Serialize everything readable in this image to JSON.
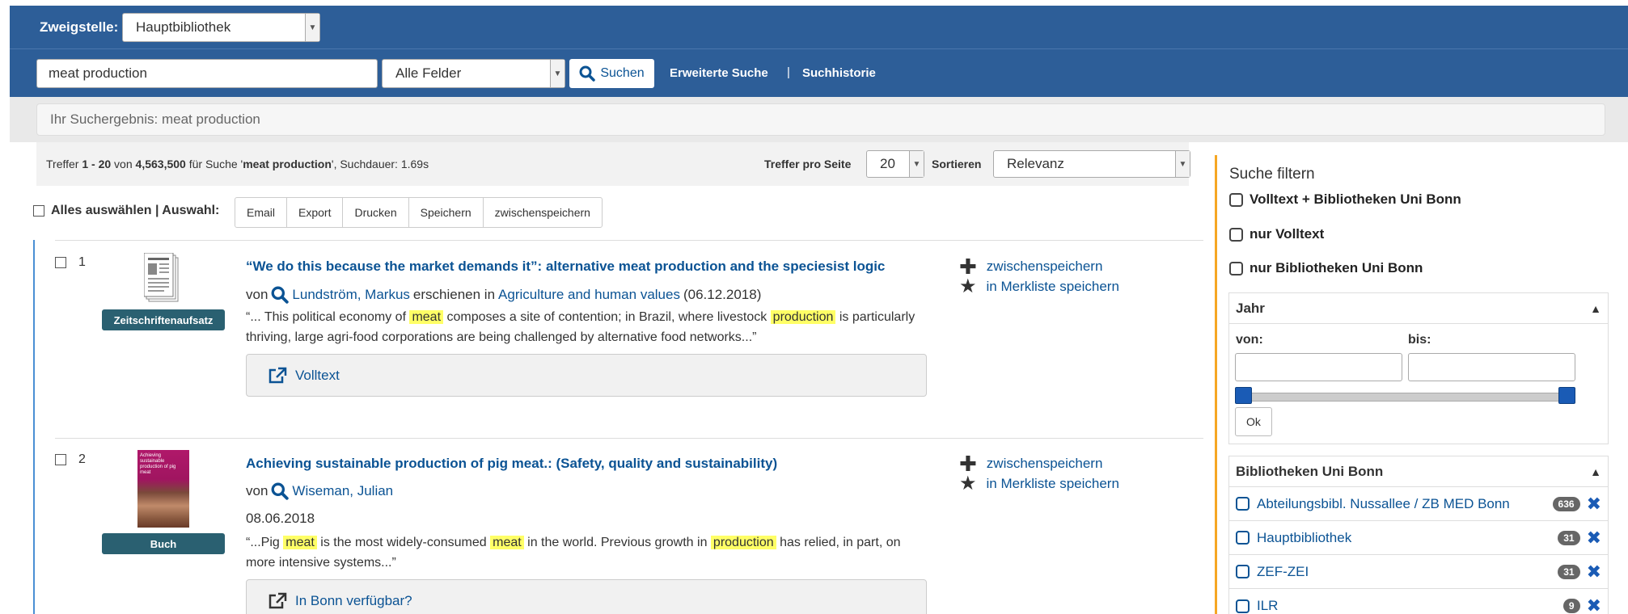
{
  "branch": {
    "label": "Zweigstelle:",
    "selected": "Hauptbibliothek"
  },
  "search": {
    "query": "meat production",
    "field": "Alle Felder",
    "button": "Suchen",
    "advanced": "Erweiterte Suche",
    "separator": "|",
    "history": "Suchhistorie"
  },
  "summary": {
    "text": "Ihr Suchergebnis: meat production"
  },
  "hits": {
    "prefix": "Treffer ",
    "range": "1 - 20",
    "of": " von ",
    "total": "4,563,500",
    "for": " für Suche '",
    "query": "meat production",
    "duration": "', Suchdauer: 1.69s",
    "per_page_label": "Treffer pro Seite",
    "per_page": "20",
    "sort_label": "Sortieren",
    "sort": "Relevanz"
  },
  "selection": {
    "label": "Alles auswählen | Auswahl:",
    "buttons": [
      "Email",
      "Export",
      "Drucken",
      "Speichern",
      "zwischenspeichern"
    ]
  },
  "results": [
    {
      "num": "1",
      "type": "Zeitschriftenaufsatz",
      "title": "“We do this because the market demands it”: alternative meat production and the speciesist logic",
      "by": "von",
      "author": "Lundström, Markus",
      "published_in": "erschienen in",
      "journal": "Agriculture and human values",
      "date": "(06.12.2018)",
      "s1": "“... This political economy of ",
      "h1": "meat",
      "s2": " composes a site of contention; in Brazil, where livestock ",
      "h2": "production",
      "s3": " is particularly thriving, large agri-food corporations are being challenged by alternative food networks...”",
      "link": "Volltext",
      "save": "zwischenspeichern",
      "watch": "in Merkliste speichern"
    },
    {
      "num": "2",
      "type": "Buch",
      "title": "Achieving sustainable production of pig meat.: (Safety, quality and sustainability)",
      "by": "von",
      "author": "Wiseman, Julian",
      "date": "08.06.2018",
      "s1": "“...Pig ",
      "h1": "meat",
      "s2": " is the most widely-consumed ",
      "h2": "meat",
      "s3": " in the world. Previous growth in ",
      "h3": "production",
      "s4": " has relied, in part, on more intensive systems...”",
      "link": "In Bonn verfügbar?",
      "save": "zwischenspeichern",
      "watch": "in Merkliste speichern",
      "cover_title": "Achieving sustainable production of pig meat"
    }
  ],
  "sidebar": {
    "heading": "Suche filtern",
    "checks": [
      "Volltext + Bibliotheken Uni Bonn",
      "nur Volltext",
      "nur Bibliotheken Uni Bonn"
    ],
    "year": {
      "title": "Jahr",
      "from": "von:",
      "to": "bis:",
      "ok": "Ok"
    },
    "libraries": {
      "title": "Bibliotheken Uni Bonn",
      "items": [
        {
          "name": "Abteilungsbibl. Nussallee / ZB MED Bonn",
          "count": "636"
        },
        {
          "name": "Hauptbibliothek",
          "count": "31"
        },
        {
          "name": "ZEF-ZEI",
          "count": "31"
        },
        {
          "name": "ILR",
          "count": "9"
        }
      ]
    }
  }
}
